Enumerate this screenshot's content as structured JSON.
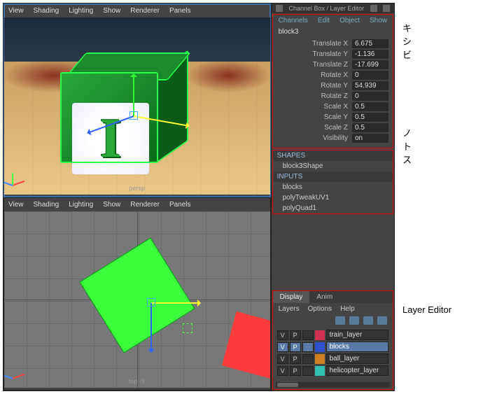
{
  "panel_title": "Channel Box / Layer Editor",
  "viewport_menu": [
    "View",
    "Shading",
    "Lighting",
    "Show",
    "Renderer",
    "Panels"
  ],
  "persp_label": "persp",
  "top_label": "top -Y",
  "channel_menu": [
    "Channels",
    "Edit",
    "Object",
    "Show"
  ],
  "object_name": "block3",
  "attrs": [
    {
      "label": "Translate X",
      "value": "6.675"
    },
    {
      "label": "Translate Y",
      "value": "-1.136"
    },
    {
      "label": "Translate Z",
      "value": "-17.699"
    },
    {
      "label": "Rotate X",
      "value": "0"
    },
    {
      "label": "Rotate Y",
      "value": "54.939"
    },
    {
      "label": "Rotate Z",
      "value": "0"
    },
    {
      "label": "Scale X",
      "value": "0.5"
    },
    {
      "label": "Scale Y",
      "value": "0.5"
    },
    {
      "label": "Scale Z",
      "value": "0.5"
    },
    {
      "label": "Visibility",
      "value": "on"
    }
  ],
  "shapes_header": "SHAPES",
  "shapes": [
    "block3Shape"
  ],
  "inputs_header": "INPUTS",
  "inputs": [
    "blocks",
    "polyTweakUV1",
    "polyQuad1"
  ],
  "layer_tabs": {
    "display": "Display",
    "anim": "Anim"
  },
  "layer_menu": [
    "Layers",
    "Options",
    "Help"
  ],
  "layer_col_v": "V",
  "layer_col_p": "P",
  "layers": [
    {
      "name": "train_layer",
      "color": "#d03050",
      "selected": false
    },
    {
      "name": "blocks",
      "color": "#3050d0",
      "selected": true
    },
    {
      "name": "ball_layer",
      "color": "#d08020",
      "selected": false
    },
    {
      "name": "helicopter_layer",
      "color": "#30c0b0",
      "selected": false
    }
  ],
  "annotations": {
    "top": "キ\nシ\nビ",
    "mid": "ノ\nト\nス",
    "bottom": "Layer Editor"
  }
}
